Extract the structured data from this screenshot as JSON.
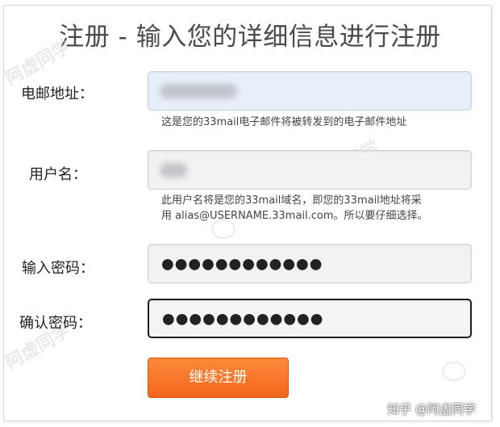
{
  "form": {
    "title": "注册 - 输入您的详细信息进行注册",
    "email": {
      "label": "电邮地址：",
      "hint": "这是您的33mail电子邮件将被转发到的电子邮件地址"
    },
    "username": {
      "label": "用户名：",
      "hint_line1": "此用户名将是您的33mail域名，即您的33mail地址将采",
      "hint_line2": "用 alias@USERNAME.33mail.com。所以要仔细选择。"
    },
    "password": {
      "label": "输入密码：",
      "value": "●●●●●●●●●●●●"
    },
    "confirm_password": {
      "label": "确认密码：",
      "value": "●●●●●●●●●●●●"
    },
    "submit_label": "继续注册"
  },
  "watermarks": {
    "left": "阿虚同学",
    "middle": "阿虚同学",
    "bottom_left": "阿虚同学",
    "footer": "知乎 @阿虚同学"
  },
  "colors": {
    "accent": "#f0661c",
    "email_field_bg": "#e8effb",
    "field_bg": "#f2f2f2"
  }
}
